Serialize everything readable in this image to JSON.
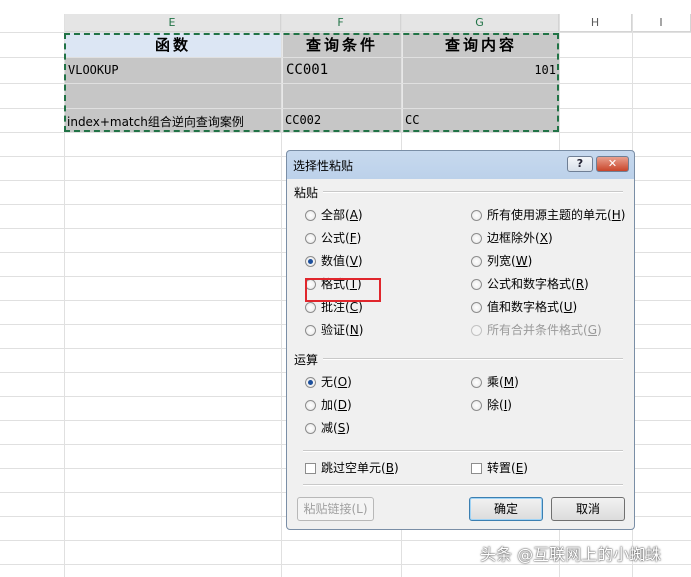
{
  "sheet": {
    "columns": [
      "E",
      "F",
      "G",
      "H",
      "I"
    ],
    "headers": [
      "函数",
      "查询条件",
      "查询内容"
    ],
    "rows": [
      [
        "VLOOKUP",
        "CC001",
        "101"
      ],
      [
        "",
        "",
        ""
      ],
      [
        "index+match组合逆向查询案例",
        "CC002",
        "CC"
      ]
    ]
  },
  "dialog": {
    "title": "选择性粘贴",
    "help_label": "?",
    "close_label": "✕",
    "paste_section": "粘贴",
    "paste_left": [
      {
        "text": "全部",
        "key": "A",
        "selected": false
      },
      {
        "text": "公式",
        "key": "F",
        "selected": false
      },
      {
        "text": "数值",
        "key": "V",
        "selected": true
      },
      {
        "text": "格式",
        "key": "T",
        "selected": false
      },
      {
        "text": "批注",
        "key": "C",
        "selected": false
      },
      {
        "text": "验证",
        "key": "N",
        "selected": false
      }
    ],
    "paste_right": [
      {
        "text": "所有使用源主题的单元",
        "key": "H",
        "selected": false,
        "disabled": false
      },
      {
        "text": "边框除外",
        "key": "X",
        "selected": false,
        "disabled": false
      },
      {
        "text": "列宽",
        "key": "W",
        "selected": false,
        "disabled": false
      },
      {
        "text": "公式和数字格式",
        "key": "R",
        "selected": false,
        "disabled": false
      },
      {
        "text": "值和数字格式",
        "key": "U",
        "selected": false,
        "disabled": false
      },
      {
        "text": "所有合并条件格式",
        "key": "G",
        "selected": false,
        "disabled": true
      }
    ],
    "operation_section": "运算",
    "op_left": [
      {
        "text": "无",
        "key": "O",
        "selected": true
      },
      {
        "text": "加",
        "key": "D",
        "selected": false
      },
      {
        "text": "减",
        "key": "S",
        "selected": false
      }
    ],
    "op_right": [
      {
        "text": "乘",
        "key": "M",
        "selected": false
      },
      {
        "text": "除",
        "key": "I",
        "selected": false
      }
    ],
    "skip_blanks": {
      "text": "跳过空单元",
      "key": "B",
      "checked": false
    },
    "transpose": {
      "text": "转置",
      "key": "E",
      "checked": false
    },
    "paste_link": "粘贴链接(L)",
    "ok": "确定",
    "cancel": "取消"
  },
  "watermark": "头条 @互联网上的小蜘蛛",
  "colors": {
    "marquee": "#217346",
    "highlight": "#e0262c"
  }
}
